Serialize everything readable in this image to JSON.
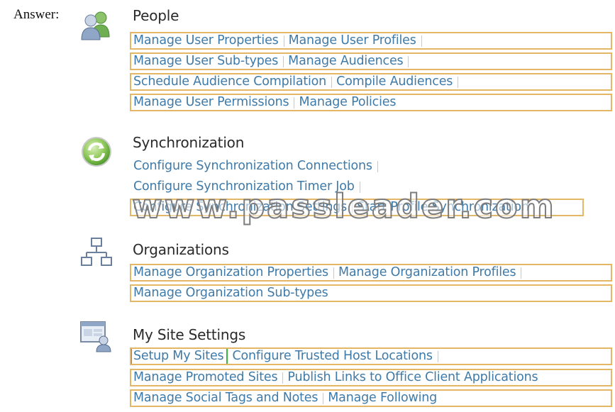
{
  "answer_label": "Answer:",
  "sections": [
    {
      "title": "People",
      "icon": "people-icon",
      "rows": [
        [
          "Manage User Properties",
          "Manage User Profiles"
        ],
        [
          "Manage User Sub-types",
          "Manage Audiences"
        ],
        [
          "Schedule Audience Compilation",
          "Compile Audiences"
        ],
        [
          "Manage User Permissions",
          "Manage Policies"
        ]
      ]
    },
    {
      "title": "Synchronization",
      "icon": "sync-icon",
      "rows": [
        [
          "Configure Synchronization Connections"
        ],
        [
          "Configure Synchronization Timer Job"
        ],
        [
          "Configure Synchronization Settings",
          "Start Profile Synchronization"
        ]
      ]
    },
    {
      "title": "Organizations",
      "icon": "org-chart-icon",
      "rows": [
        [
          "Manage Organization Properties",
          "Manage Organization Profiles"
        ],
        [
          "Manage Organization Sub-types"
        ]
      ]
    },
    {
      "title": "My Site Settings",
      "icon": "my-site-icon",
      "rows": [
        [
          "Setup My Sites",
          "Configure Trusted Host Locations"
        ],
        [
          "Manage Promoted Sites",
          "Publish Links to Office Client Applications"
        ],
        [
          "Manage Social Tags and Notes",
          "Manage Following"
        ]
      ]
    }
  ],
  "watermark": "www.passleader.com",
  "colors": {
    "link": "#3f7aa8",
    "row_border": "#e3b765",
    "highlight_border": "#3bb53b"
  }
}
